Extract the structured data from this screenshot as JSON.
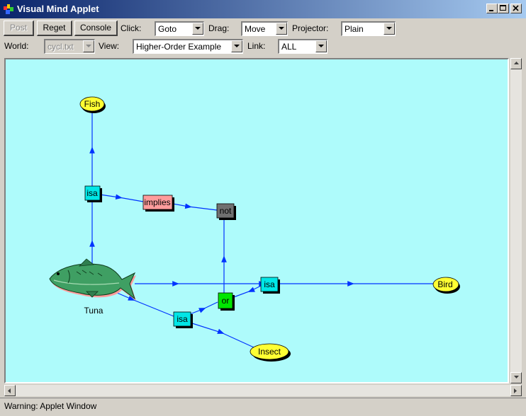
{
  "window": {
    "title": "Visual Mind Applet"
  },
  "toolbar": {
    "post_label": "Post",
    "reget_label": "Reget",
    "console_label": "Console",
    "click_label": "Click:",
    "click_value": "Goto",
    "drag_label": "Drag:",
    "drag_value": "Move",
    "projector_label": "Projector:",
    "projector_value": "Plain",
    "world_label": "World:",
    "world_value": "cycl.txt",
    "view_label": "View:",
    "view_value": "Higher-Order Example",
    "link_label": "Link:",
    "link_value": "ALL"
  },
  "graph": {
    "nodes": {
      "fish": "Fish",
      "bird": "Bird",
      "insect": "Insect",
      "isa_top": "isa",
      "isa_right": "isa",
      "isa_bottom": "isa",
      "implies": "implies",
      "not": "not",
      "or": "or",
      "tuna": "Tuna"
    },
    "colors": {
      "canvas": "#aefbfb",
      "edge": "#0033ff",
      "concept": "#ffff33",
      "isa": "#00e6e6",
      "implies": "#ff9c9c",
      "not": "#707070",
      "or": "#00e600",
      "fish_body": "#3f9f63"
    }
  },
  "status": {
    "text": "Warning: Applet Window"
  }
}
